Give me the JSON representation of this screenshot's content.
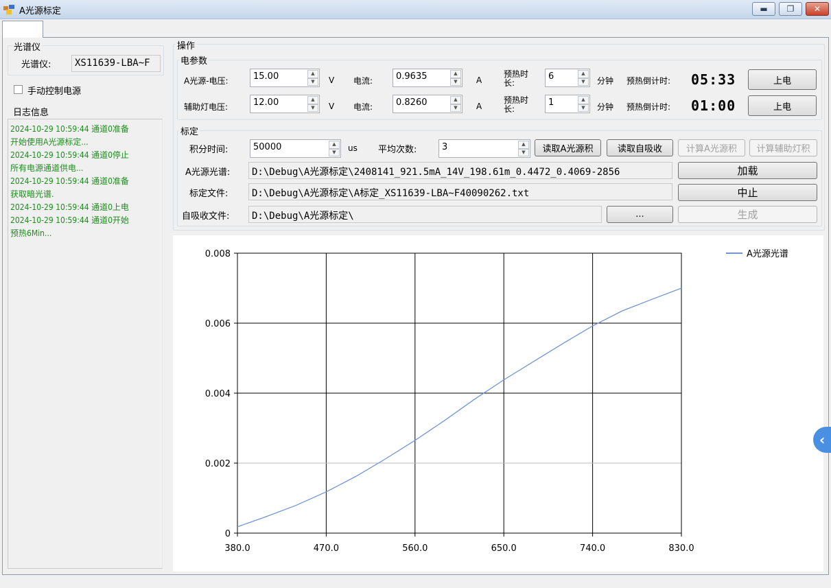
{
  "window": {
    "title": "A光源标定",
    "controls": {
      "minimize": "▬",
      "maximize": "❐",
      "close": "✕"
    },
    "tab_label": ""
  },
  "spectrometer": {
    "group_title": "光谱仪",
    "label": "光谱仪:",
    "value": "XS11639-LBA~F"
  },
  "manual_power": {
    "label": "手动控制电源",
    "checked": false
  },
  "log": {
    "title": "日志信息",
    "lines": [
      "2024-10-29 10:59:44   通道0准备",
      "开始使用A光源标定...",
      "2024-10-29 10:59:44   通道0停止",
      "所有电源通道供电...",
      "2024-10-29 10:59:44   通道0准备",
      "获取暗光谱.",
      "2024-10-29 10:59:44   通道0上电",
      "2024-10-29 10:59:44   通道0开始",
      "预热6Min..."
    ]
  },
  "operation": {
    "title": "操作",
    "electrical": {
      "title": "电参数",
      "rows": [
        {
          "voltage_label": "A光源-电压:",
          "voltage": "15.00",
          "voltage_unit": "V",
          "current_label": "电流:",
          "current": "0.9635",
          "current_unit": "A",
          "preheat_label": "预热时长:",
          "preheat": "6",
          "preheat_unit": "分钟",
          "countdown_label": "预热倒计时:",
          "countdown": "05:33",
          "power_button": "上电"
        },
        {
          "voltage_label": "辅助灯电压:",
          "voltage": "12.00",
          "voltage_unit": "V",
          "current_label": "电流:",
          "current": "0.8260",
          "current_unit": "A",
          "preheat_label": "预热时长:",
          "preheat": "1",
          "preheat_unit": "分钟",
          "countdown_label": "预热倒计时:",
          "countdown": "01:00",
          "power_button": "上电"
        }
      ]
    },
    "calibration": {
      "title": "标定",
      "integration_label": "积分时间:",
      "integration_value": "50000",
      "integration_unit": "us",
      "avg_label": "平均次数:",
      "avg_value": "3",
      "buttons": {
        "read_a_integral": "读取A光源积",
        "read_self_absorption": "读取自吸收",
        "calc_a_integral": "计算A光源积",
        "calc_aux_integral": "计算辅助灯积",
        "load": "加载",
        "stop": "中止",
        "browse": "...",
        "generate": "生成"
      },
      "a_spectrum_label": "A光源光谱:",
      "a_spectrum_path": "D:\\Debug\\A光源标定\\2408141_921.5mA_14V_198.61m_0.4472_0.4069-2856",
      "calib_file_label": "标定文件:",
      "calib_file_path": "D:\\Debug\\A光源标定\\A标定_XS11639-LBA~F40090262.txt",
      "self_abs_label": "自吸收文件:",
      "self_abs_path": "D:\\Debug\\A光源标定\\"
    }
  },
  "chart_data": {
    "type": "line",
    "title": "",
    "xlabel": "",
    "ylabel": "",
    "xlim": [
      380,
      830
    ],
    "ylim": [
      0,
      0.008
    ],
    "x_ticks": [
      "380.0",
      "470.0",
      "560.0",
      "650.0",
      "740.0",
      "830.0"
    ],
    "y_ticks": [
      "0",
      "0.002",
      "0.004",
      "0.006",
      "0.008"
    ],
    "grid": true,
    "legend": "top-right",
    "series": [
      {
        "name": "A光源光谱",
        "color": "#6f95d6",
        "x": [
          380,
          410,
          440,
          470,
          500,
          530,
          560,
          590,
          620,
          650,
          680,
          710,
          740,
          770,
          800,
          830
        ],
        "y": [
          0.00018,
          0.00048,
          0.0008,
          0.00118,
          0.00162,
          0.00212,
          0.00265,
          0.00322,
          0.00382,
          0.00438,
          0.0049,
          0.00542,
          0.00592,
          0.00635,
          0.00668,
          0.007
        ]
      }
    ]
  }
}
